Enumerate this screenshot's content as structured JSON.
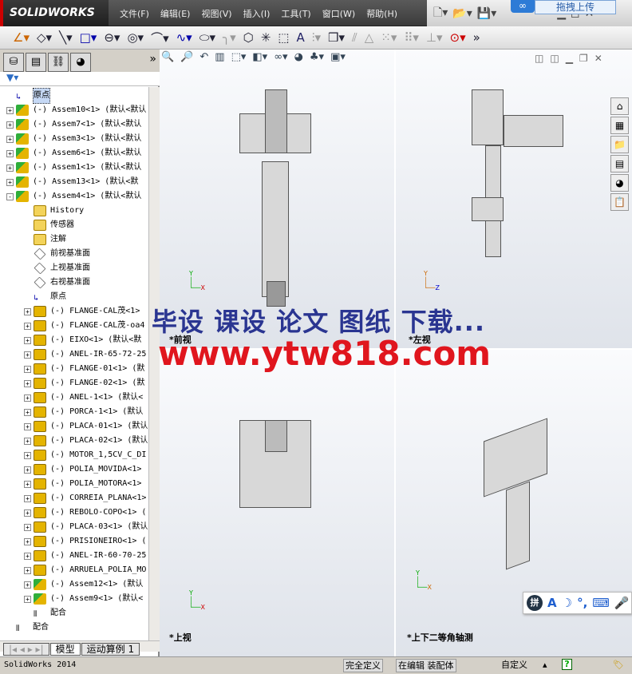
{
  "app": {
    "logo": "SOLIDWORKS",
    "version_status": "SolidWorks 2014"
  },
  "menu": [
    "文件(F)",
    "编辑(E)",
    "视图(V)",
    "插入(I)",
    "工具(T)",
    "窗口(W)",
    "帮助(H)"
  ],
  "upload_badge": "拖拽上传",
  "toolbar_icons": [
    "sketch-icon",
    "smart-dimension-icon",
    "line-icon",
    "rectangle-icon",
    "slot-icon",
    "circle-icon",
    "arc-icon",
    "spline-icon",
    "ellipse-icon",
    "fillet-icon",
    "polygon-icon",
    "point-icon",
    "construction-icon",
    "text-icon",
    "mirror-icon",
    "offset-icon",
    "trim-icon",
    "convert-icon",
    "pattern-icon",
    "move-icon",
    "relations-icon",
    "repair-icon",
    "more-icon"
  ],
  "panel_tabs": [
    "feature-manager-icon",
    "property-manager-icon",
    "configuration-manager-icon",
    "appearance-icon"
  ],
  "tree": [
    {
      "level": 0,
      "type": "origin",
      "label": "原点",
      "selected": true
    },
    {
      "level": 0,
      "type": "asm",
      "pm": "+",
      "label": "(-) Assem10<1> (默认<默认"
    },
    {
      "level": 0,
      "type": "asm",
      "pm": "+",
      "label": "(-) Assem7<1> (默认<默认"
    },
    {
      "level": 0,
      "type": "asm",
      "pm": "+",
      "label": "(-) Assem3<1> (默认<默认"
    },
    {
      "level": 0,
      "type": "asm",
      "pm": "+",
      "label": "(-) Assem6<1> (默认<默认"
    },
    {
      "level": 0,
      "type": "asm",
      "pm": "+",
      "label": "(-) Assem1<1> (默认<默认"
    },
    {
      "level": 0,
      "type": "asm",
      "pm": "+",
      "label": "(-) Assem13<1> (默认<默"
    },
    {
      "level": 0,
      "type": "asm",
      "pm": "-",
      "label": "(-) Assem4<1> (默认<默认"
    },
    {
      "level": 1,
      "type": "fold",
      "label": "History"
    },
    {
      "level": 1,
      "type": "fold",
      "label": "传感器"
    },
    {
      "level": 1,
      "type": "fold",
      "label": "注解"
    },
    {
      "level": 1,
      "type": "plane",
      "label": "前视基准面"
    },
    {
      "level": 1,
      "type": "plane",
      "label": "上视基准面"
    },
    {
      "level": 1,
      "type": "plane",
      "label": "右视基准面"
    },
    {
      "level": 1,
      "type": "origin",
      "label": "原点"
    },
    {
      "level": 1,
      "type": "prt",
      "pm": "+",
      "label": "(-) FLANGE-CAL茂<1>"
    },
    {
      "level": 1,
      "type": "prt",
      "pm": "+",
      "label": "(-) FLANGE-CAL茂-oa4"
    },
    {
      "level": 1,
      "type": "prt",
      "pm": "+",
      "label": "(-) EIXO<1> (默认<默"
    },
    {
      "level": 1,
      "type": "prt",
      "pm": "+",
      "label": "(-) ANEL-IR-65-72-25"
    },
    {
      "level": 1,
      "type": "prt",
      "pm": "+",
      "label": "(-) FLANGE-01<1> (默"
    },
    {
      "level": 1,
      "type": "prt",
      "pm": "+",
      "label": "(-) FLANGE-02<1> (默"
    },
    {
      "level": 1,
      "type": "prt",
      "pm": "+",
      "label": "(-) ANEL-1<1> (默认<"
    },
    {
      "level": 1,
      "type": "prt",
      "pm": "+",
      "label": "(-) PORCA-1<1> (默认"
    },
    {
      "level": 1,
      "type": "prt",
      "pm": "+",
      "label": "(-) PLACA-01<1> (默认"
    },
    {
      "level": 1,
      "type": "prt",
      "pm": "+",
      "label": "(-) PLACA-02<1> (默认"
    },
    {
      "level": 1,
      "type": "prt",
      "pm": "+",
      "label": "(-) MOTOR_1,5CV_C_DI"
    },
    {
      "level": 1,
      "type": "prt",
      "pm": "+",
      "label": "(-) POLIA_MOVIDA<1>"
    },
    {
      "level": 1,
      "type": "prt",
      "pm": "+",
      "label": "(-) POLIA_MOTORA<1>"
    },
    {
      "level": 1,
      "type": "prt",
      "pm": "+",
      "label": "(-) CORREIA_PLANA<1>"
    },
    {
      "level": 1,
      "type": "prt",
      "pm": "+",
      "label": "(-) REBOLO-COPO<1> ("
    },
    {
      "level": 1,
      "type": "prt",
      "pm": "+",
      "label": "(-) PLACA-03<1> (默认"
    },
    {
      "level": 1,
      "type": "prt",
      "pm": "+",
      "label": "(-) PRISIONEIRO<1> ("
    },
    {
      "level": 1,
      "type": "prt",
      "pm": "+",
      "label": "(-) ANEL-IR-60-70-25"
    },
    {
      "level": 1,
      "type": "prt",
      "pm": "+",
      "label": "(-) ARRUELA_POLIA_MO"
    },
    {
      "level": 1,
      "type": "asm",
      "pm": "+",
      "label": "(-) Assem12<1> (默认"
    },
    {
      "level": 1,
      "type": "asm",
      "pm": "+",
      "label": "(-) Assem9<1> (默认<"
    },
    {
      "level": 1,
      "type": "mate",
      "label": "配合"
    },
    {
      "level": 0,
      "type": "mate",
      "label": "配合"
    }
  ],
  "bottom_tabs": [
    "模型",
    "运动算例 1"
  ],
  "views": {
    "front": "*前视",
    "left": "*左视",
    "top": "*上视",
    "iso": "*上下二等角轴测"
  },
  "status": {
    "defined": "完全定义",
    "editing": "在编辑 装配体",
    "custom": "自定义"
  },
  "watermark": {
    "line1": "毕设 课设 论文 图纸 下载...",
    "line2": "www.ytw818.com"
  }
}
